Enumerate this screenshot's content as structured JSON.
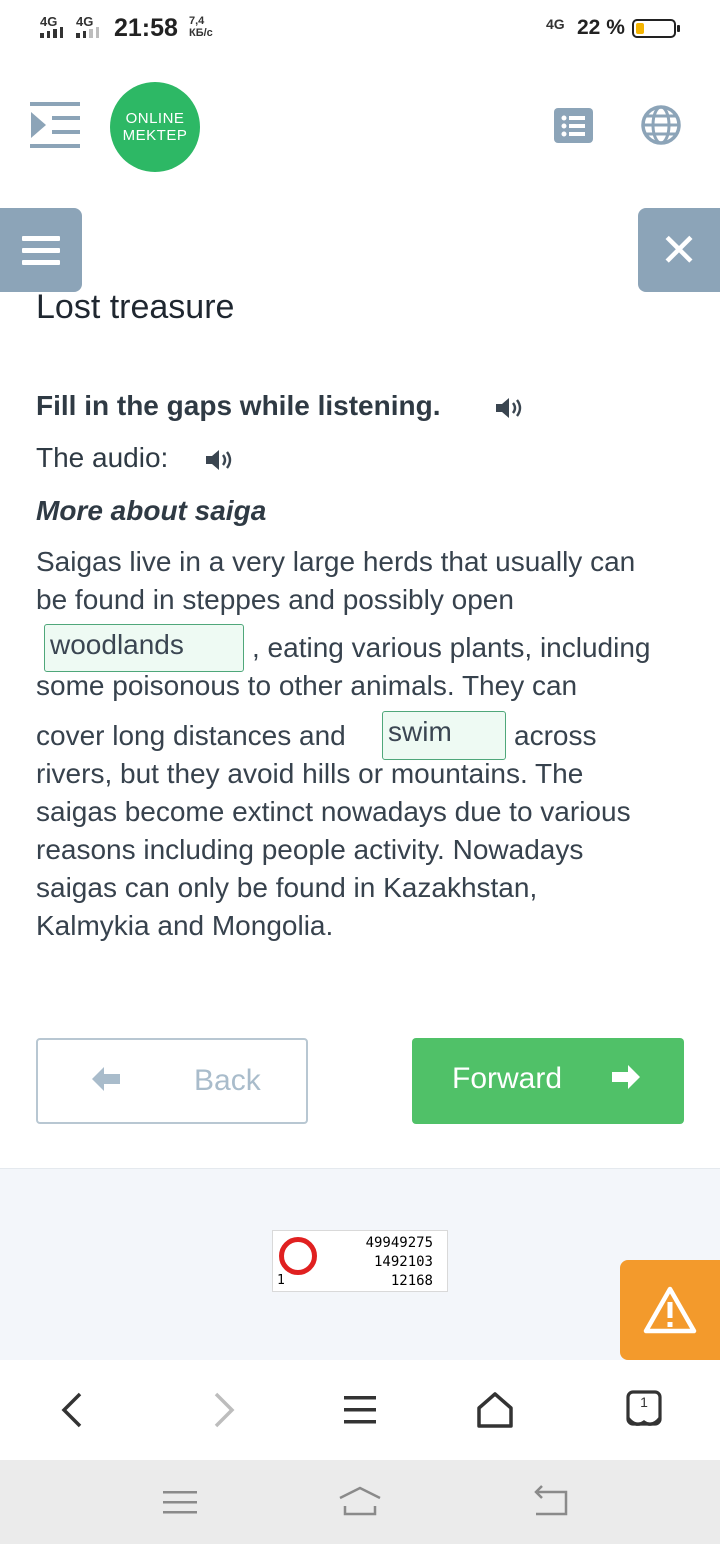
{
  "status_bar": {
    "net1": "4G",
    "net2": "4G",
    "time": "21:58",
    "speed_value": "7,4",
    "speed_unit": "КБ/с",
    "net_right": "4G",
    "battery_pct": "22 %",
    "battery_level": 0.22,
    "battery_color": "#f4b400"
  },
  "header": {
    "menu_icon": "menu-indent-icon",
    "logo_line1": "ONLINE",
    "logo_line2": "MEKTEP",
    "logo_color": "#2db865",
    "list_icon": "list-icon",
    "globe_icon": "globe-icon"
  },
  "floating": {
    "menu_icon": "hamburger-icon",
    "close_label": "✕"
  },
  "content": {
    "title": "Lost treasure",
    "instruction": "Fill in the gaps while listening.",
    "audio_label": "The audio:",
    "subtitle": "More about saiga",
    "passage": {
      "line1": "Saigas live in a very large herds that usually can",
      "line2": "be found in steppes and possibly open",
      "gap1": "woodlands",
      "line3": ", eating various plants, including",
      "line4": "some poisonous to other animals. They can",
      "line5a": "cover long distances and",
      "gap2": "swim",
      "line5b": "across",
      "line6": "rivers, but they avoid hills or mountains. The",
      "line7": "saigas become extinct nowadays due to various",
      "line8": "reasons including people activity. Nowadays",
      "line9": "saigas can only be found in Kazakhstan,",
      "line10": "Kalmykia and Mongolia."
    }
  },
  "navigation": {
    "back_label": "Back",
    "forward_label": "Forward",
    "accent": "#50c168"
  },
  "counter": {
    "small": "1",
    "n1": "49949275",
    "n2": "1492103",
    "n3": "12168"
  },
  "report": {
    "icon": "warning-icon",
    "color": "#f39a2c"
  },
  "browser_nav": {
    "tab_count": "1"
  }
}
